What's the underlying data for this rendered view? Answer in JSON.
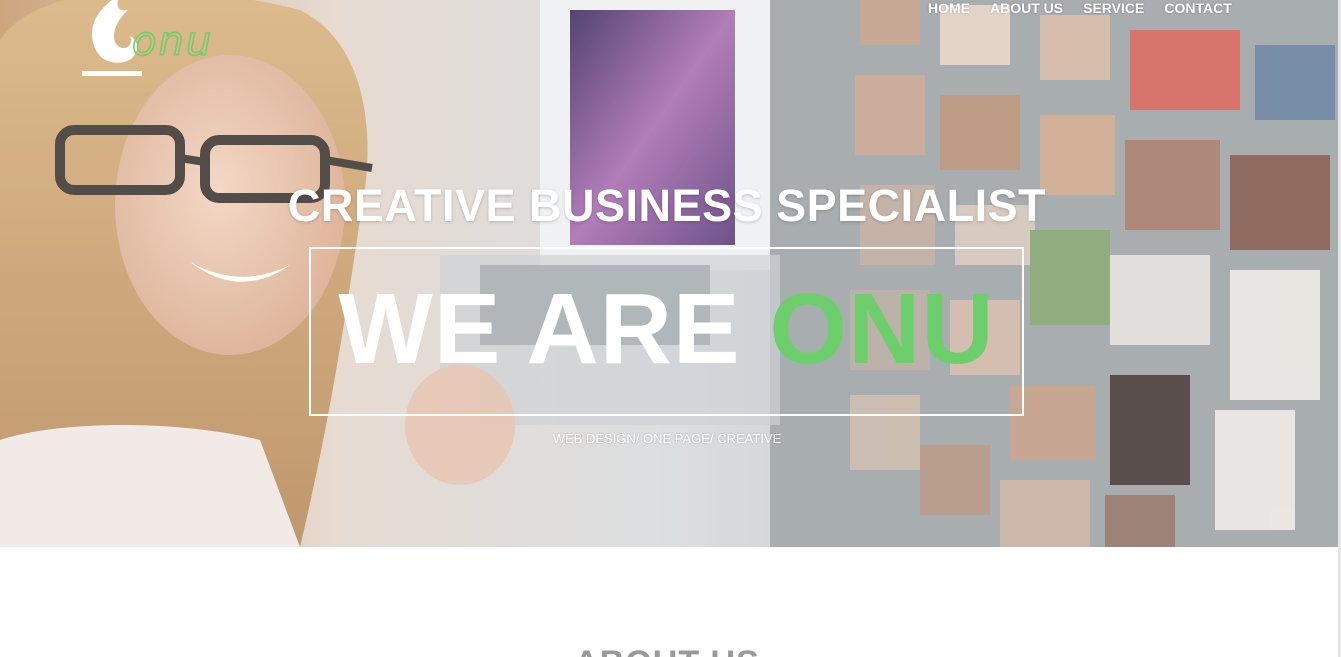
{
  "brand": {
    "logo_text": "onu",
    "accent_color": "#6ccf6a"
  },
  "nav": {
    "items": [
      {
        "label": "HOME"
      },
      {
        "label": "ABOUT US"
      },
      {
        "label": "SERVICE"
      },
      {
        "label": "CONTACT"
      }
    ]
  },
  "hero": {
    "subtitle": "CREATIVE BUSINESS SPECIALIST",
    "title_white": "WE ARE ",
    "title_green": "ONU",
    "tagline": "WEB DESIGN/ ONE PAGE/ CREATIVE"
  },
  "about": {
    "heading": "ABOUT US"
  }
}
